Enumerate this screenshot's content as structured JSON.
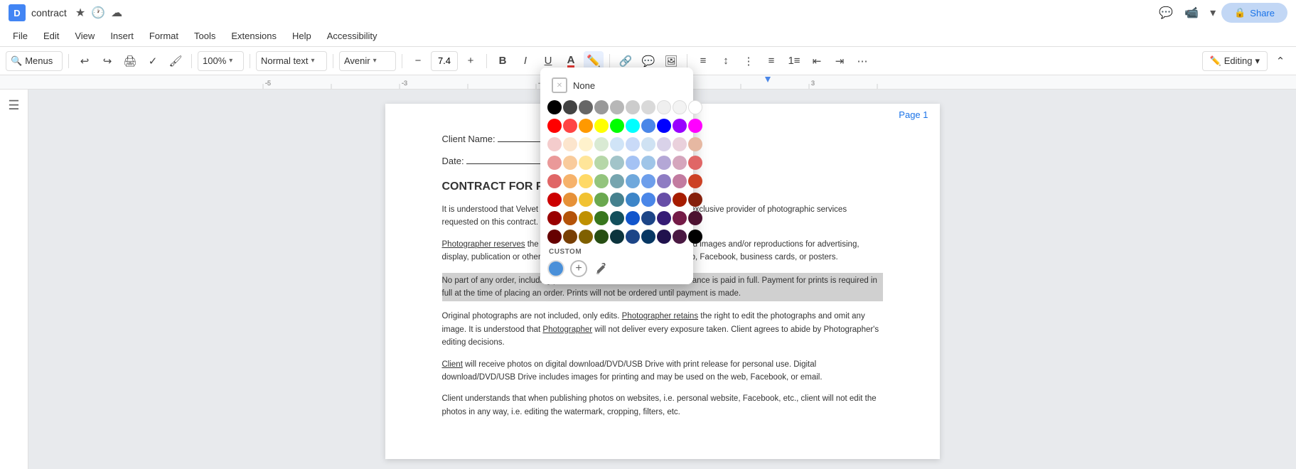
{
  "titleBar": {
    "appIconLabel": "D",
    "docTitle": "contract",
    "starIcon": "★",
    "historyIcon": "🕐",
    "cloudIcon": "☁",
    "shareLabel": "Share",
    "shareIcon": "🔒",
    "systemIcons": [
      "💬",
      "📹",
      "▾"
    ]
  },
  "menuBar": {
    "items": [
      "File",
      "Edit",
      "View",
      "Insert",
      "Format",
      "Tools",
      "Extensions",
      "Help",
      "Accessibility"
    ]
  },
  "toolbar": {
    "searchLabel": "Menus",
    "undoIcon": "↩",
    "redoIcon": "↪",
    "printIcon": "🖨",
    "spellcheckIcon": "✓",
    "paintFormatIcon": "🖌",
    "zoomValue": "100%",
    "normalTextLabel": "Normal text",
    "fontLabel": "Avenir",
    "fontSizeDecrease": "−",
    "fontSizeValue": "7.4",
    "fontSizeIncrease": "+",
    "boldLabel": "B",
    "italicLabel": "I",
    "underlineLabel": "U",
    "textColorIcon": "A",
    "highlightIcon": "✏",
    "linkIcon": "🔗",
    "commentIcon": "💬",
    "imageIcon": "🖼",
    "alignIcon": "≡",
    "lineSpacingIcon": "↕",
    "listOptionsIcon": "⋮",
    "bulletListIcon": "≡",
    "numberedListIcon": "1≡",
    "decreaseIndentIcon": "⇤",
    "increaseIndentIcon": "⇥",
    "moreOptionsIcon": "⋯",
    "editingLabel": "Editing",
    "editingArrow": "▾",
    "collapseIcon": "⌃"
  },
  "colorPicker": {
    "noneLabel": "None",
    "customLabel": "CUSTOM",
    "colors": {
      "row1": [
        "#000000",
        "#434343",
        "#666666",
        "#999999",
        "#b7b7b7",
        "#cccccc",
        "#d9d9d9",
        "#efefef",
        "#f3f3f3",
        "#ffffff"
      ],
      "row2": [
        "#ff0000",
        "#ff4444",
        "#ff9900",
        "#ffff00",
        "#00ff00",
        "#00ffff",
        "#4a86e8",
        "#0000ff",
        "#9900ff",
        "#ff00ff"
      ],
      "row3": [
        "#f4cccc",
        "#fce5cd",
        "#fff2cc",
        "#d9ead3",
        "#d0e4f7",
        "#c9daf8",
        "#cfe2f3",
        "#d9d2e9",
        "#ead1dc",
        "#e6b8a2"
      ],
      "row4": [
        "#ea9999",
        "#f9cb9c",
        "#ffe599",
        "#b6d7a8",
        "#a2c4c9",
        "#a4c2f4",
        "#9fc5e8",
        "#b4a7d6",
        "#d5a6bd",
        "#e06666"
      ],
      "row5": [
        "#e06666",
        "#f6b26b",
        "#ffd966",
        "#93c47d",
        "#76a5af",
        "#6fa8dc",
        "#6d9eeb",
        "#8e7cc3",
        "#c27ba0",
        "#cc4125"
      ],
      "row6": [
        "#cc0000",
        "#e69138",
        "#f1c232",
        "#6aa84f",
        "#45818e",
        "#3d85c8",
        "#4a86e8",
        "#674ea7",
        "#a61c00",
        "#85200c"
      ],
      "row7": [
        "#990000",
        "#b45309",
        "#bf9000",
        "#38761d",
        "#134f5c",
        "#1155cc",
        "#1c4587",
        "#351c75",
        "#741b47",
        "#4c1130"
      ],
      "row8": [
        "#660000",
        "#783f04",
        "#7f6000",
        "#274e13",
        "#0c343d",
        "#1c4587",
        "#073763",
        "#20124d",
        "#4a1942",
        "#000000"
      ]
    },
    "customColor": "#4a90d9"
  },
  "document": {
    "clientNameLabel": "Client Name: ",
    "dateLabel": "Date: ",
    "pageLabel": "Page 1",
    "contractTitle": "CONTRACT FOR PHOTOGRAPHIC SERVICES",
    "paragraphs": [
      "It is understood that Velvet Lotus Photography (Photographer) is the exclusive provider of photographic services requested on this contract.",
      "Photographer reserves the right to use negatives, RAW images, edited images and/or reproductions for advertising, display, publication or other purposes, not restricted to use on the web, Facebook, business cards, or posters.",
      "No part of any order, including previews, will be delivered until the balance is paid in full. Payment for prints is required in full at the time of  placing an order. Prints will not be ordered until payment is made.",
      "Original photographs are not included, only edits. Photographer retains the right to edit the photographs and omit any image. It is understood  that Photographer will not deliver every exposure taken. Client agrees to abide by Photographer's editing decisions.",
      "Client will receive photos on digital download/DVD/USB Drive with print release for personal use. Digital download/DVD/USB Drive includes  images for printing and may be used on the web, Facebook, or email.",
      "Client understands that when publishing photos on websites, i.e. personal website, Facebook, etc., client will not edit the photos in any way, i.e. editing the watermark, cropping, filters, etc."
    ]
  }
}
